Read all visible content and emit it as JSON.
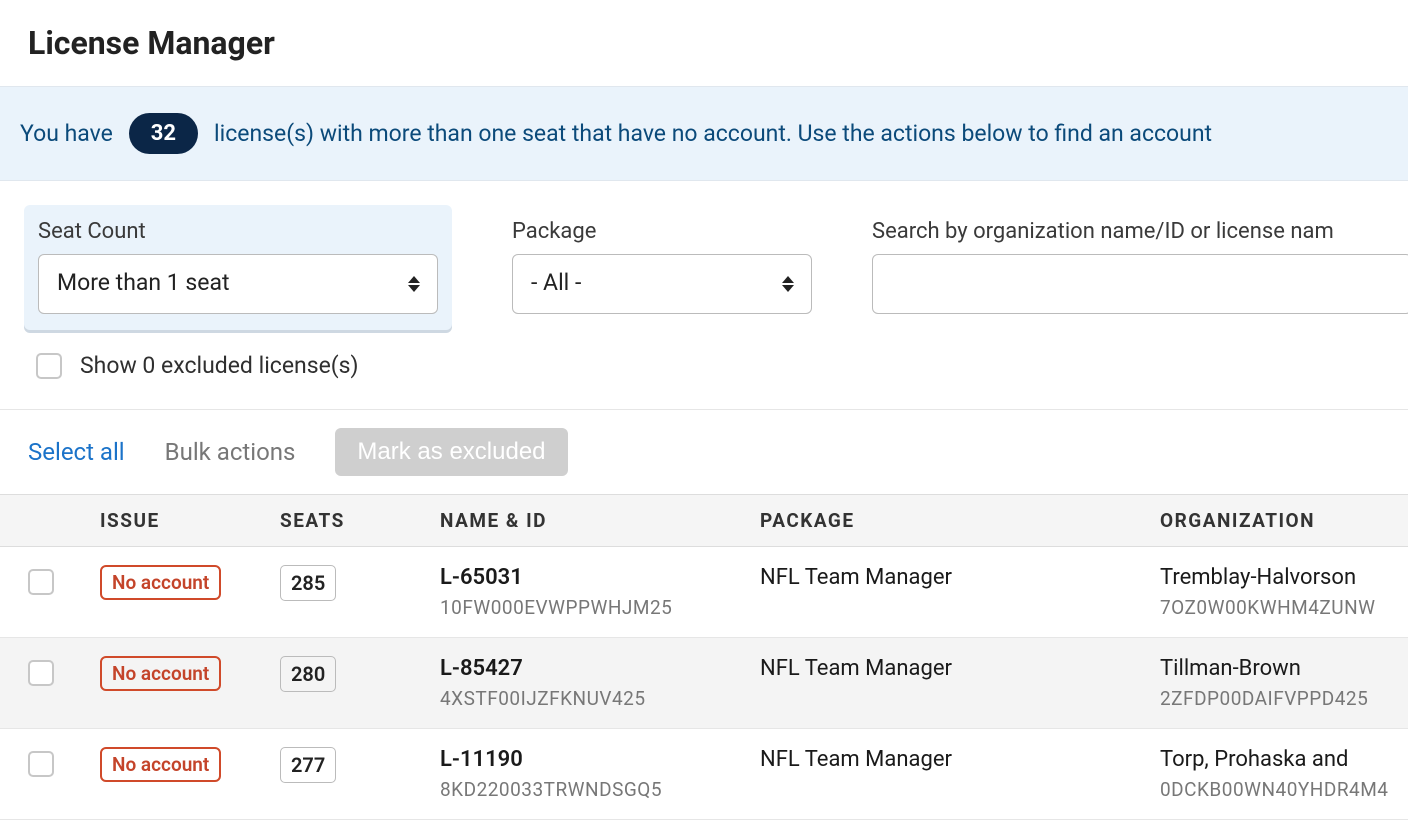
{
  "page_title": "License Manager",
  "banner": {
    "prefix": "You have",
    "count": "32",
    "suffix": "license(s) with more than one seat that have no account. Use the actions below to find an account "
  },
  "filters": {
    "seat_count": {
      "label": "Seat Count",
      "value": "More than 1 seat"
    },
    "package": {
      "label": "Package",
      "value": "- All -"
    },
    "search": {
      "label": "Search by organization name/ID or license nam"
    }
  },
  "excluded": {
    "label": "Show 0 excluded license(s)"
  },
  "actions": {
    "select_all": "Select all",
    "bulk_label": "Bulk actions",
    "mark_excluded": "Mark as excluded"
  },
  "table": {
    "headers": {
      "issue": "ISSUE",
      "seats": "SEATS",
      "name": "NAME & ID",
      "package": "PACKAGE",
      "org": "ORGANIZATION"
    },
    "rows": [
      {
        "issue": "No account",
        "seats": "285",
        "name": "L-65031",
        "id": "10FW000EVWPPWHJM25",
        "package": "NFL Team Manager",
        "org_name": "Tremblay-Halvorson",
        "org_id": "7OZ0W00KWHM4ZUNW"
      },
      {
        "issue": "No account",
        "seats": "280",
        "name": "L-85427",
        "id": "4XSTF00IJZFKNUV425",
        "package": "NFL Team Manager",
        "org_name": "Tillman-Brown",
        "org_id": "2ZFDP00DAIFVPPD425"
      },
      {
        "issue": "No account",
        "seats": "277",
        "name": "L-11190",
        "id": "8KD220033TRWNDSGQ5",
        "package": "NFL Team Manager",
        "org_name": "Torp, Prohaska and ",
        "org_id": "0DCKB00WN40YHDR4M4"
      }
    ]
  }
}
